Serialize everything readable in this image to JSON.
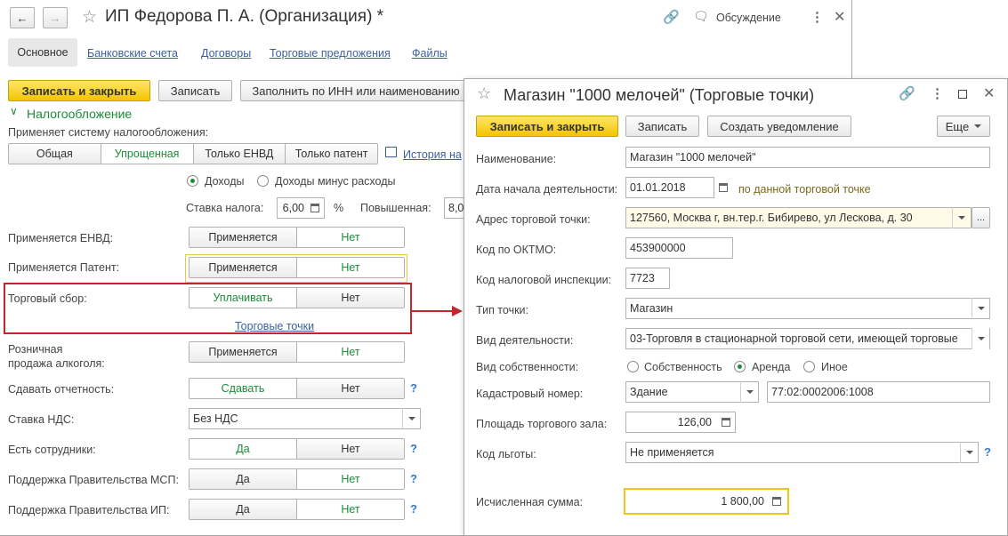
{
  "main": {
    "title": "ИП Федорова П. А. (Организация) *",
    "discussion": "Обсуждение",
    "tabs": [
      "Основное",
      "Банковские счета",
      "Договоры",
      "Торговые предложения",
      "Файлы"
    ],
    "toolbar": {
      "save_close": "Записать и закрыть",
      "save": "Записать",
      "fill_inn": "Заполнить по ИНН или наименованию"
    },
    "tax_section_title": "Налогообложение",
    "tax_system_label": "Применяет систему налогообложения:",
    "tax_systems": [
      "Общая",
      "Упрощенная",
      "Только ЕНВД",
      "Только патент"
    ],
    "tax_system_selected": "Упрощенная",
    "history_link": "История на",
    "income_radio": "Доходы",
    "income_minus_radio": "Доходы минус расходы",
    "tax_rate_label": "Ставка налога:",
    "tax_rate_value": "6,00",
    "percent": "%",
    "increased_label": "Повышенная:",
    "increased_value": "8,0",
    "rows": [
      {
        "label": "Применяется ЕНВД:",
        "opt1": "Применяется",
        "opt2": "Нет",
        "selected": 2
      },
      {
        "label": "Применяется Патент:",
        "opt1": "Применяется",
        "opt2": "Нет",
        "selected": 2
      },
      {
        "label": "Торговый сбор:",
        "opt1": "Уплачивать",
        "opt2": "Нет",
        "selected": 1
      },
      {
        "label": "Розничная\nпродажа алкоголя:",
        "opt1": "Применяется",
        "opt2": "Нет",
        "selected": 2
      },
      {
        "label": "Сдавать отчетность:",
        "opt1": "Сдавать",
        "opt2": "Нет",
        "selected": 1
      },
      {
        "label": "Есть сотрудники:",
        "opt1": "Да",
        "opt2": "Нет",
        "selected": 1
      },
      {
        "label": "Поддержка Правительства МСП:",
        "opt1": "Да",
        "opt2": "Нет",
        "selected": 2
      },
      {
        "label": "Поддержка Правительства ИП:",
        "opt1": "Да",
        "opt2": "Нет",
        "selected": 2
      }
    ],
    "trade_points_link": "Торговые точки",
    "vat_label": "Ставка НДС:",
    "vat_value": "Без НДС",
    "help": "?"
  },
  "dialog": {
    "title": "Магазин \"1000 мелочей\" (Торговые точки)",
    "toolbar": {
      "save_close": "Записать и закрыть",
      "save": "Записать",
      "notify": "Создать уведомление",
      "more": "Еще"
    },
    "fields": {
      "name_label": "Наименование:",
      "name_value": "Магазин \"1000 мелочей\"",
      "start_label": "Дата начала деятельности:",
      "start_value": "01.01.2018",
      "start_note": "по данной торговой точке",
      "address_label": "Адрес торговой точки:",
      "address_value": "127560, Москва г, вн.тер.г. Бибирево, ул Лескова, д. 30",
      "oktmo_label": "Код по ОКТМО:",
      "oktmo_value": "453900000",
      "tax_office_label": "Код налоговой инспекции:",
      "tax_office_value": "7723",
      "point_type_label": "Тип точки:",
      "point_type_value": "Магазин",
      "activity_label": "Вид деятельности:",
      "activity_value": "03-Торговля в стационарной торговой сети, имеющей торговые",
      "ownership_label": "Вид собственности:",
      "ownership_options": [
        "Собственность",
        "Аренда",
        "Иное"
      ],
      "ownership_selected": "Аренда",
      "cadastral_label": "Кадастровый номер:",
      "cadastral_type": "Здание",
      "cadastral_value": "77:02:0002006:1008",
      "area_label": "Площадь торгового зала:",
      "area_value": "126,00",
      "benefit_label": "Код льготы:",
      "benefit_value": "Не применяется",
      "sum_label": "Исчисленная сумма:",
      "sum_value": "1 800,00"
    }
  }
}
